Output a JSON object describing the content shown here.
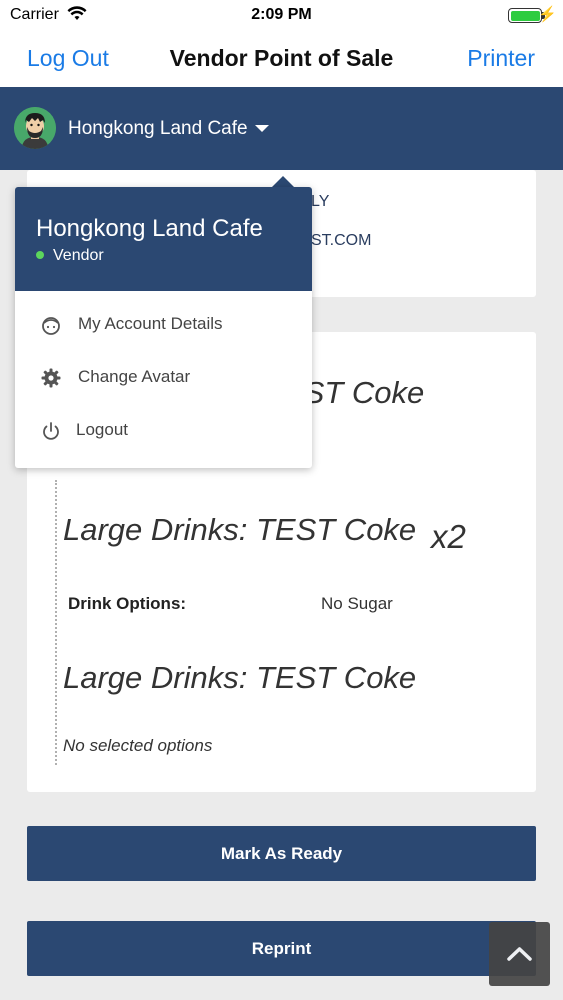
{
  "status_bar": {
    "carrier": "Carrier",
    "time": "2:09 PM"
  },
  "nav": {
    "left": "Log Out",
    "title": "Vendor Point of Sale",
    "right": "Printer"
  },
  "header": {
    "vendor_name": "Hongkong Land Cafe"
  },
  "top_card": {
    "line1": "LY",
    "line2": "ST.COM"
  },
  "order": {
    "partial_title": "EST Coke",
    "items": [
      {
        "title": "Large Drinks: TEST Coke",
        "qty": "x2",
        "option_label": "Drink Options:",
        "option_value": "No Sugar"
      },
      {
        "title": "Large Drinks: TEST Coke",
        "note": "No selected options"
      }
    ]
  },
  "buttons": {
    "mark_ready": "Mark As Ready",
    "reprint": "Reprint"
  },
  "dropdown": {
    "name": "Hongkong Land Cafe",
    "role": "Vendor",
    "items": [
      {
        "label": "My Account Details",
        "icon": "face-icon"
      },
      {
        "label": "Change Avatar",
        "icon": "gear-icon"
      },
      {
        "label": "Logout",
        "icon": "power-icon"
      }
    ]
  },
  "colors": {
    "primary": "#2b4872",
    "link": "#1a7be6",
    "online": "#5cd65c",
    "avatar_bg": "#48a86a"
  }
}
